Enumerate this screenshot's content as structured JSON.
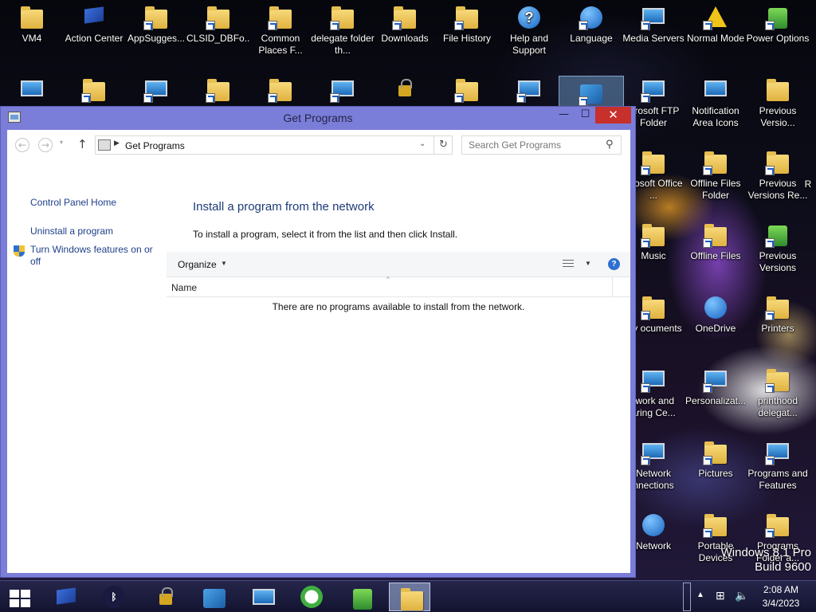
{
  "desktop": {
    "row1": [
      {
        "label": "VM4",
        "icon": "folder-icon"
      },
      {
        "label": "Action Center",
        "icon": "action-center-flag-icon"
      },
      {
        "label": "AppSugges...",
        "icon": "folder-star-shortcut-icon"
      },
      {
        "label": "CLSID_DBFo...",
        "icon": "folder-shortcut-icon"
      },
      {
        "label": "Common Places F...",
        "icon": "folder-shortcut-icon"
      },
      {
        "label": "delegate folder th...",
        "icon": "folder-shortcut-icon"
      },
      {
        "label": "Downloads",
        "icon": "downloads-folder-icon"
      },
      {
        "label": "File History",
        "icon": "file-history-icon"
      },
      {
        "label": "Help and Support",
        "icon": "help-icon"
      },
      {
        "label": "Language",
        "icon": "language-globe-icon"
      },
      {
        "label": "Media Servers",
        "icon": "media-servers-icon"
      },
      {
        "label": "Normal Mode",
        "icon": "warning-icon"
      },
      {
        "label": "Power Options",
        "icon": "power-options-icon"
      }
    ],
    "row2": [
      {
        "label": "",
        "icon": "computer-monitor-icon"
      },
      {
        "label": "",
        "icon": "folder-shortcut-icon"
      },
      {
        "label": "",
        "icon": "media-player-icon"
      },
      {
        "label": "",
        "icon": "folder-shortcut-icon"
      },
      {
        "label": "",
        "icon": "folder-shortcut-icon"
      },
      {
        "label": "",
        "icon": "documents-shortcut-icon"
      },
      {
        "label": "",
        "icon": "lock-icon"
      },
      {
        "label": "",
        "icon": "file-history-shortcut-icon"
      },
      {
        "label": "",
        "icon": "display-shortcut-icon"
      },
      {
        "label": "",
        "icon": "get-programs-icon"
      }
    ],
    "right_column": [
      {
        "label": "icrosoft FTP Folder",
        "icon": "ftp-folder-icon"
      },
      {
        "label": "Notification Area Icons",
        "icon": "notification-area-icon"
      },
      {
        "label": "Previous Versio...",
        "icon": "folder-icon"
      },
      {
        "label": "icrosoft Office ...",
        "icon": "office-folder-icon"
      },
      {
        "label": "Offline Files Folder",
        "icon": "offline-files-folder-icon"
      },
      {
        "label": "Previous Versions Re...",
        "icon": "folder-icon"
      },
      {
        "label": "R",
        "icon": "partial-icon"
      },
      {
        "label": "Music",
        "icon": "music-folder-icon"
      },
      {
        "label": "Offline Files",
        "icon": "offline-files-icon"
      },
      {
        "label": "Previous Versions",
        "icon": "previous-versions-icon"
      },
      {
        "label": "My ocuments",
        "icon": "documents-folder-icon"
      },
      {
        "label": "OneDrive",
        "icon": "onedrive-icon"
      },
      {
        "label": "Printers",
        "icon": "printers-icon"
      },
      {
        "label": "twork and aring Ce...",
        "icon": "network-sharing-icon"
      },
      {
        "label": "Personalizat...",
        "icon": "personalization-icon"
      },
      {
        "label": "printhood delegat...",
        "icon": "folder-shortcut-icon"
      },
      {
        "label": "Network nnections",
        "icon": "network-connections-icon"
      },
      {
        "label": "Pictures",
        "icon": "pictures-folder-icon"
      },
      {
        "label": "Programs and Features",
        "icon": "programs-features-icon"
      },
      {
        "label": "Network",
        "icon": "network-icon"
      },
      {
        "label": "Portable Devices",
        "icon": "portable-devices-icon"
      },
      {
        "label": "Programs Folder a...",
        "icon": "folder-shortcut-icon"
      }
    ]
  },
  "window": {
    "title": "Get Programs",
    "minimize_glyph": "—",
    "maximize_glyph": "☐",
    "close_glyph": "✕",
    "nav": {
      "back_glyph": "←",
      "forward_glyph": "→",
      "recent_glyph": "▾",
      "up_glyph": "↑",
      "address_separator": "▶",
      "address": "Get Programs",
      "dropdown_glyph": "⌄",
      "refresh_glyph": "↻",
      "search_placeholder": "Search Get Programs",
      "search_glyph": "⚲"
    },
    "left_pane": {
      "home": "Control Panel Home",
      "uninstall": "Uninstall a program",
      "features": "Turn Windows features on or off"
    },
    "main": {
      "heading": "Install a program from the network",
      "description": "To install a program, select it from the list and then click Install.",
      "organize": "Organize",
      "caret": "▼",
      "help_glyph": "?",
      "sort_glyph": "^",
      "column_name": "Name",
      "empty_message": "There are no programs available to install from the network."
    }
  },
  "watermark": {
    "line1": "Windows 8.1 Pro",
    "line2": "Build 9600"
  },
  "taskbar": {
    "items": [
      {
        "name": "action-center-flag-icon"
      },
      {
        "name": "bluetooth-icon"
      },
      {
        "name": "keys-icon"
      },
      {
        "name": "control-panel-icon"
      },
      {
        "name": "network-drive-icon"
      },
      {
        "name": "clock-arrow-icon"
      },
      {
        "name": "battery-icon"
      },
      {
        "name": "file-explorer-icon",
        "active": true
      }
    ],
    "tray": {
      "expand_glyph": "▲",
      "network_glyph": "⊞",
      "volume_glyph": "🔈"
    },
    "clock": {
      "time": "2:08 AM",
      "date": "3/4/2023"
    }
  },
  "colors": {
    "window_frame": "#7b7ed8",
    "close_button": "#c7302b",
    "link": "#1e3f8a",
    "heading": "#1e3a78"
  }
}
